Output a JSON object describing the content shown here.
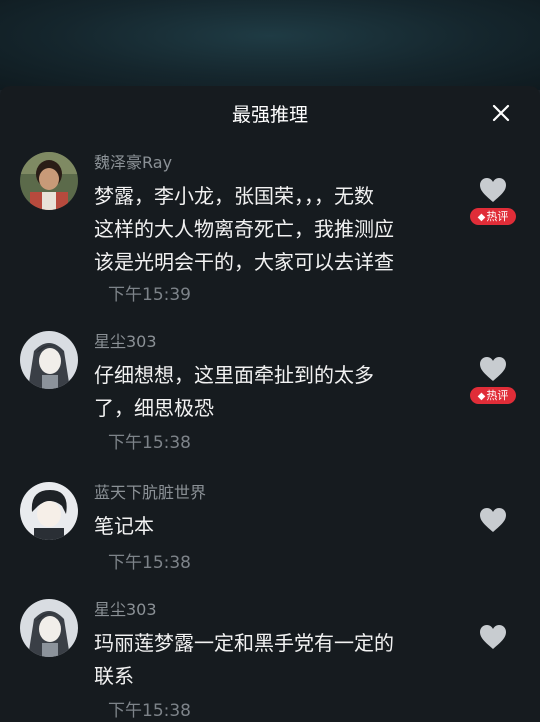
{
  "sheet": {
    "title": "最强推理"
  },
  "comments": [
    {
      "username": "魏泽豪Ray",
      "lines": [
        "梦露，李小龙，张国荣，，，无数",
        "这样的大人物离奇死亡，我推测应",
        "该是光明会干的，大家可以去详查"
      ],
      "time": "下午15:39",
      "hot_label": "热评",
      "avatar_icon": "photo-avatar-icon"
    },
    {
      "username": "星尘303",
      "lines": [
        "仔细想想，这里面牵扯到的太多",
        "了，细思极恐"
      ],
      "time": "下午15:38",
      "hot_label": "热评",
      "avatar_icon": "anime-avatar-icon"
    },
    {
      "username": "蓝天下肮脏世界",
      "lines": [
        "笔记本"
      ],
      "time": "下午15:38",
      "avatar_icon": "anime-boy-avatar-icon"
    },
    {
      "username": "星尘303",
      "lines": [
        "玛丽莲梦露一定和黑手党有一定的",
        "联系"
      ],
      "time": "下午15:38",
      "avatar_icon": "anime-avatar-icon"
    }
  ],
  "icons": {
    "close": "close-icon",
    "like": "heart-icon",
    "fire": "fire-icon"
  },
  "colors": {
    "hot_badge": "#e02d38",
    "background": "#161b1f",
    "username": "#8b9196"
  }
}
